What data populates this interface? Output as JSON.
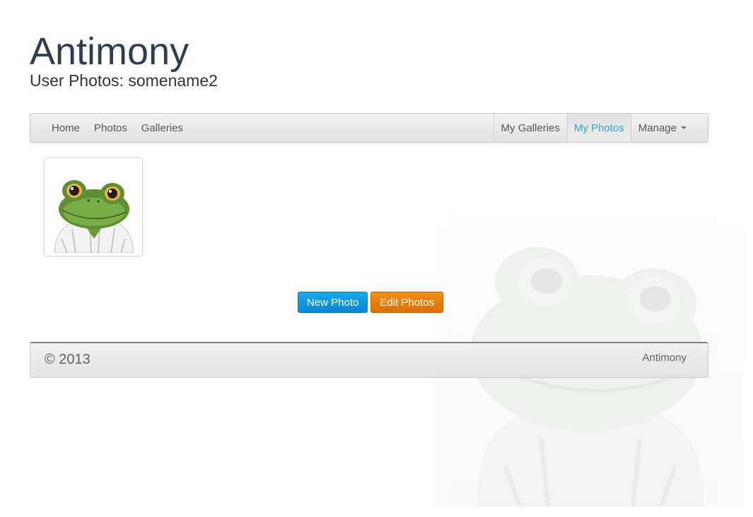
{
  "header": {
    "title": "Antimony",
    "subtitle": "User Photos: somename2"
  },
  "nav": {
    "left": [
      {
        "label": "Home"
      },
      {
        "label": "Photos"
      },
      {
        "label": "Galleries"
      }
    ],
    "right": [
      {
        "label": "My Galleries",
        "active": false
      },
      {
        "label": "My Photos",
        "active": true
      },
      {
        "label": "Manage",
        "dropdown": true
      }
    ]
  },
  "photos": [
    {
      "icon": "frog-photo"
    }
  ],
  "actions": {
    "new_photo": "New Photo",
    "edit_photos": "Edit Photos"
  },
  "footer": {
    "copyright": "© 2013",
    "brand": "Antimony"
  },
  "colors": {
    "title": "#2c3e50",
    "nav_active": "#3a9fd8",
    "primary": "#0a95e0",
    "warning": "#e67e0b"
  }
}
